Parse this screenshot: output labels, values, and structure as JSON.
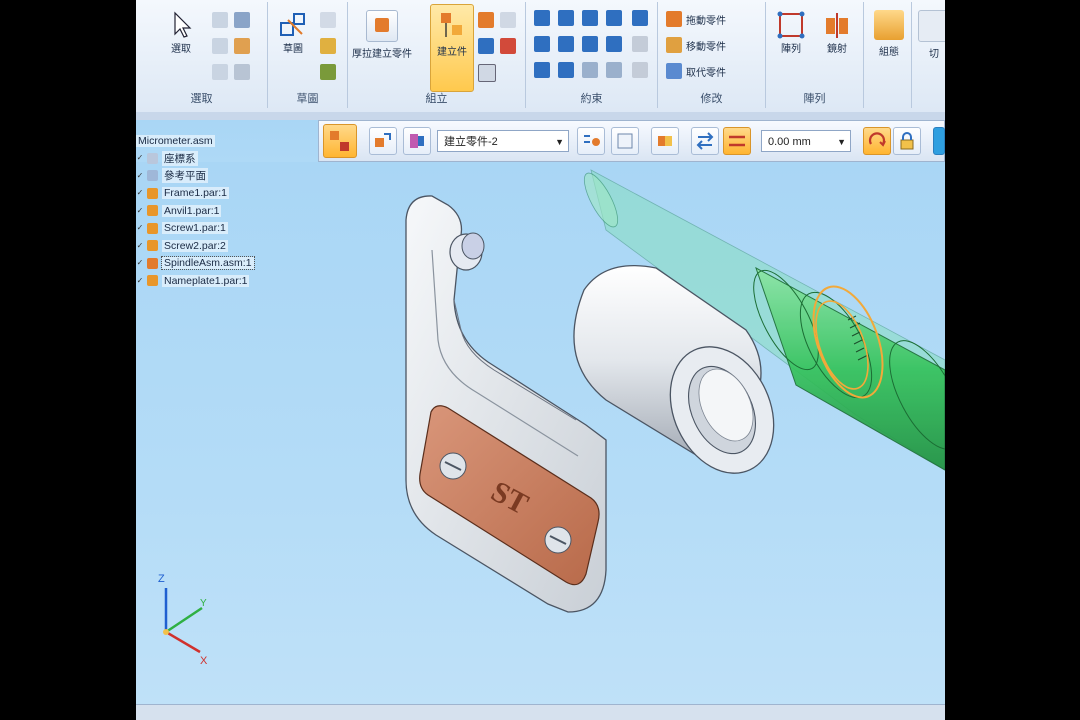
{
  "ribbon": {
    "groups": [
      {
        "label": "選取",
        "big_label": "選取"
      },
      {
        "label": "草圖",
        "big_label": "草圖"
      },
      {
        "label": "組立",
        "big1_label": "厚拉建立零件",
        "big2_label": "建立件"
      },
      {
        "label": "約束"
      },
      {
        "label": "修改",
        "rows": [
          "拖動零件",
          "移動零件",
          "取代零件"
        ]
      },
      {
        "label": "陣列",
        "big1_label": "陣列",
        "big2_label": "鏡射"
      },
      {
        "label": "",
        "big_label": "組態"
      },
      {
        "label": "",
        "big_label": "切"
      }
    ]
  },
  "command_bar": {
    "relationship_select": "建立零件-2",
    "offset_value": "0.00 mm"
  },
  "pathfinder": {
    "root": "Micrometer.asm",
    "items": [
      {
        "label": "座標系",
        "checked": true
      },
      {
        "label": "參考平面",
        "checked": true
      },
      {
        "label": "Frame1.par:1",
        "checked": true
      },
      {
        "label": "Anvil1.par:1",
        "checked": true
      },
      {
        "label": "Screw1.par:1",
        "checked": true
      },
      {
        "label": "Screw2.par:2",
        "checked": true
      },
      {
        "label": "SpindleAsm.asm:1",
        "checked": true,
        "selected": true
      },
      {
        "label": "Nameplate1.par:1",
        "checked": true
      }
    ]
  },
  "model": {
    "nameplate_text": "ST"
  },
  "triad": {
    "z": "Z",
    "y": "Y",
    "x": "X"
  },
  "colors": {
    "frame": "#e9ecf0",
    "nameplate": "#c8805f",
    "spindle_green": "#34c25a",
    "highlight": "#f2a93a",
    "viewport": "#b0d9f6",
    "ribbon_active": "#ffc94d"
  }
}
